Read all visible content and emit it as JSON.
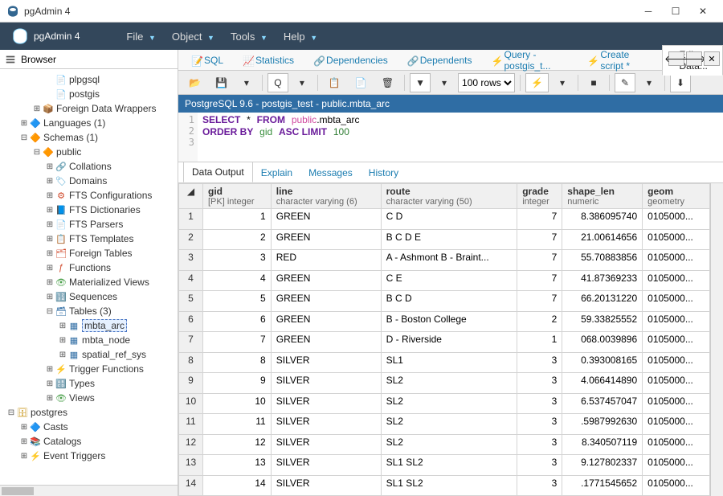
{
  "window": {
    "title": "pgAdmin 4"
  },
  "brand": "pgAdmin 4",
  "menus": [
    "File",
    "Object",
    "Tools",
    "Help"
  ],
  "browser": {
    "title": "Browser"
  },
  "tree": [
    {
      "depth": 3,
      "twisty": "",
      "icon": "📄",
      "label": "plpgsql"
    },
    {
      "depth": 3,
      "twisty": "",
      "icon": "📄",
      "label": "postgis"
    },
    {
      "depth": 2,
      "twisty": "+",
      "icon": "📦",
      "label": "Foreign Data Wrappers",
      "iconColor": "#c28a00"
    },
    {
      "depth": 1,
      "twisty": "+",
      "icon": "🔷",
      "label": "Languages (1)",
      "iconColor": "#f0b400"
    },
    {
      "depth": 1,
      "twisty": "−",
      "icon": "🔶",
      "label": "Schemas (1)",
      "iconColor": "#d04a2b"
    },
    {
      "depth": 2,
      "twisty": "−",
      "icon": "🔶",
      "label": "public",
      "iconColor": "#d04a2b"
    },
    {
      "depth": 3,
      "twisty": "+",
      "icon": "🔗",
      "label": "Collations",
      "iconColor": "#d04a2b"
    },
    {
      "depth": 3,
      "twisty": "+",
      "icon": "🏷",
      "label": "Domains",
      "iconColor": "#4aa4d0"
    },
    {
      "depth": 3,
      "twisty": "+",
      "icon": "⚙",
      "label": "FTS Configurations",
      "iconColor": "#d04a2b"
    },
    {
      "depth": 3,
      "twisty": "+",
      "icon": "📘",
      "label": "FTS Dictionaries",
      "iconColor": "#2f6da4"
    },
    {
      "depth": 3,
      "twisty": "+",
      "icon": "📄",
      "label": "FTS Parsers",
      "iconColor": "#4ba04b"
    },
    {
      "depth": 3,
      "twisty": "+",
      "icon": "📋",
      "label": "FTS Templates",
      "iconColor": "#d04a2b"
    },
    {
      "depth": 3,
      "twisty": "+",
      "icon": "🗂",
      "label": "Foreign Tables",
      "iconColor": "#d04a2b"
    },
    {
      "depth": 3,
      "twisty": "+",
      "icon": "ƒ",
      "label": "Functions",
      "iconColor": "#d04a2b"
    },
    {
      "depth": 3,
      "twisty": "+",
      "icon": "👁",
      "label": "Materialized Views",
      "iconColor": "#4ba04b"
    },
    {
      "depth": 3,
      "twisty": "+",
      "icon": "🔢",
      "label": "Sequences",
      "iconColor": "#d04a2b"
    },
    {
      "depth": 3,
      "twisty": "−",
      "icon": "🗃",
      "label": "Tables (3)",
      "iconColor": "#2f6da4"
    },
    {
      "depth": 4,
      "twisty": "+",
      "icon": "▦",
      "label": "mbta_arc",
      "selected": true,
      "iconColor": "#2f6da4"
    },
    {
      "depth": 4,
      "twisty": "+",
      "icon": "▦",
      "label": "mbta_node",
      "iconColor": "#2f6da4"
    },
    {
      "depth": 4,
      "twisty": "+",
      "icon": "▦",
      "label": "spatial_ref_sys",
      "iconColor": "#2f6da4"
    },
    {
      "depth": 3,
      "twisty": "+",
      "icon": "⚡",
      "label": "Trigger Functions",
      "iconColor": "#4ba04b"
    },
    {
      "depth": 3,
      "twisty": "+",
      "icon": "🔠",
      "label": "Types",
      "iconColor": "#d04a2b"
    },
    {
      "depth": 3,
      "twisty": "+",
      "icon": "👁",
      "label": "Views",
      "iconColor": "#4ba04b"
    },
    {
      "depth": 0,
      "twisty": "−",
      "icon": "🗄",
      "label": "postgres",
      "iconColor": "#c28a00"
    },
    {
      "depth": 1,
      "twisty": "+",
      "icon": "🔷",
      "label": "Casts",
      "iconColor": "#4aa4d0"
    },
    {
      "depth": 1,
      "twisty": "+",
      "icon": "📚",
      "label": "Catalogs",
      "iconColor": "#4ba04b"
    },
    {
      "depth": 1,
      "twisty": "+",
      "icon": "⚡",
      "label": "Event Triggers",
      "iconColor": "#d04a2b"
    }
  ],
  "tabs": {
    "items": [
      {
        "label": "SQL",
        "icon": "📝"
      },
      {
        "label": "Statistics",
        "icon": "📈"
      },
      {
        "label": "Dependencies",
        "icon": "🔗"
      },
      {
        "label": "Dependents",
        "icon": "🔗"
      },
      {
        "label": "Query - postgis_t...",
        "icon": "⚡"
      },
      {
        "label": "Create script *",
        "icon": "⚡"
      },
      {
        "label": "Edit Data...",
        "icon": "✎",
        "active": true
      }
    ]
  },
  "toolbar": {
    "rows_label": "100 rows"
  },
  "context": "PostgreSQL 9.6 - postgis_test - public.mbta_arc",
  "sql": {
    "line1_a": "SELECT",
    "line1_b": "*",
    "line1_c": "FROM",
    "line1_d": "public",
    "line1_e": ".mbta_arc",
    "line2_a": "ORDER BY",
    "line2_b": "gid",
    "line2_c": "ASC LIMIT",
    "line2_d": "100"
  },
  "subtabs": [
    "Data Output",
    "Explain",
    "Messages",
    "History"
  ],
  "columns": [
    {
      "name": "gid",
      "type": "[PK] integer"
    },
    {
      "name": "line",
      "type": "character varying (6)"
    },
    {
      "name": "route",
      "type": "character varying (50)"
    },
    {
      "name": "grade",
      "type": "integer"
    },
    {
      "name": "shape_len",
      "type": "numeric"
    },
    {
      "name": "geom",
      "type": "geometry"
    }
  ],
  "rows": [
    {
      "n": 1,
      "gid": 1,
      "line": "GREEN",
      "route": "C D",
      "grade": 7,
      "shape_len": "8.386095740",
      "geom": "0105000..."
    },
    {
      "n": 2,
      "gid": 2,
      "line": "GREEN",
      "route": "B C D E",
      "grade": 7,
      "shape_len": "21.00614656",
      "geom": "0105000..."
    },
    {
      "n": 3,
      "gid": 3,
      "line": "RED",
      "route": "A - Ashmont B - Braint...",
      "grade": 7,
      "shape_len": "55.70883856",
      "geom": "0105000..."
    },
    {
      "n": 4,
      "gid": 4,
      "line": "GREEN",
      "route": "C E",
      "grade": 7,
      "shape_len": "41.87369233",
      "geom": "0105000..."
    },
    {
      "n": 5,
      "gid": 5,
      "line": "GREEN",
      "route": "B C D",
      "grade": 7,
      "shape_len": "66.20131220",
      "geom": "0105000..."
    },
    {
      "n": 6,
      "gid": 6,
      "line": "GREEN",
      "route": "B - Boston College",
      "grade": 2,
      "shape_len": "59.33825552",
      "geom": "0105000..."
    },
    {
      "n": 7,
      "gid": 7,
      "line": "GREEN",
      "route": "D - Riverside",
      "grade": 1,
      "shape_len": "068.0039896",
      "geom": "0105000..."
    },
    {
      "n": 8,
      "gid": 8,
      "line": "SILVER",
      "route": "SL1",
      "grade": 3,
      "shape_len": "0.393008165",
      "geom": "0105000..."
    },
    {
      "n": 9,
      "gid": 9,
      "line": "SILVER",
      "route": "SL2",
      "grade": 3,
      "shape_len": "4.066414890",
      "geom": "0105000..."
    },
    {
      "n": 10,
      "gid": 10,
      "line": "SILVER",
      "route": "SL2",
      "grade": 3,
      "shape_len": "6.537457047",
      "geom": "0105000..."
    },
    {
      "n": 11,
      "gid": 11,
      "line": "SILVER",
      "route": "SL2",
      "grade": 3,
      "shape_len": ".5987992630",
      "geom": "0105000..."
    },
    {
      "n": 12,
      "gid": 12,
      "line": "SILVER",
      "route": "SL2",
      "grade": 3,
      "shape_len": "8.340507119",
      "geom": "0105000..."
    },
    {
      "n": 13,
      "gid": 13,
      "line": "SILVER",
      "route": "SL1 SL2",
      "grade": 3,
      "shape_len": "9.127802337",
      "geom": "0105000..."
    },
    {
      "n": 14,
      "gid": 14,
      "line": "SILVER",
      "route": "SL1 SL2",
      "grade": 3,
      "shape_len": ".1771545652",
      "geom": "0105000..."
    }
  ]
}
